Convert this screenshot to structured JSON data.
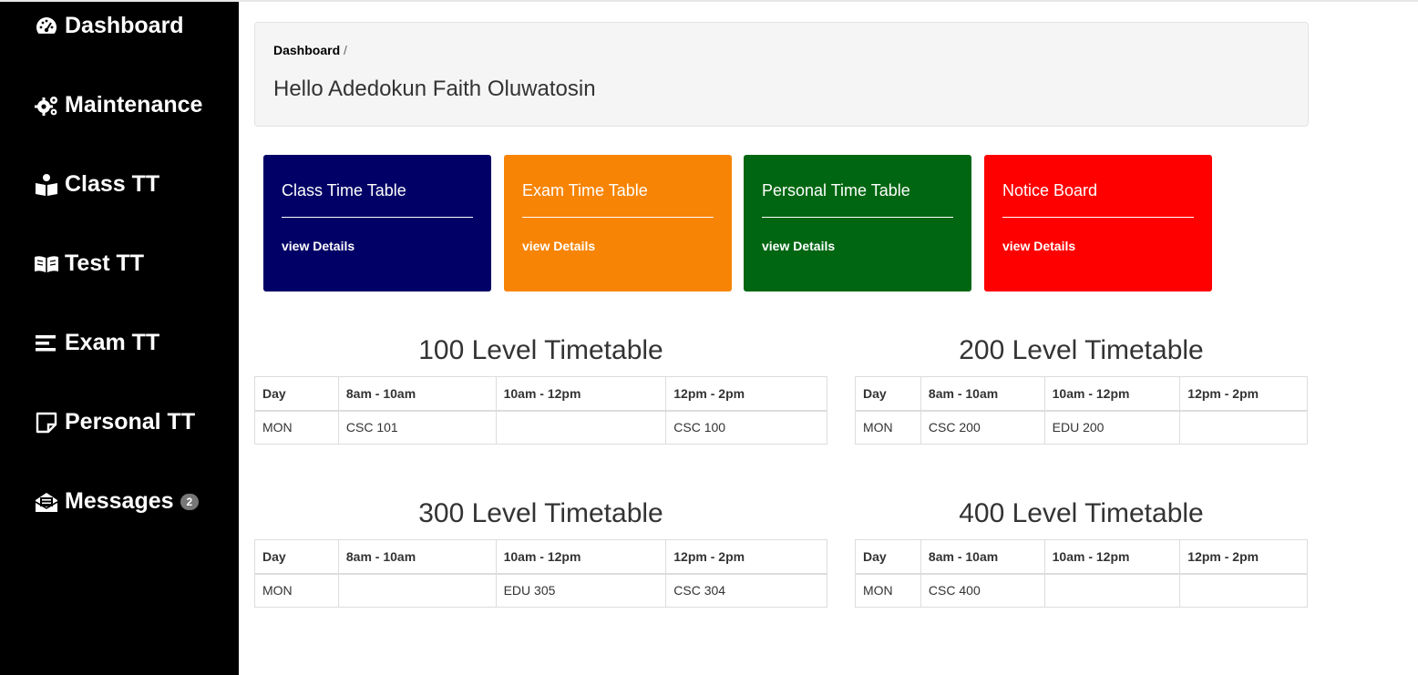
{
  "sidebar": {
    "items": [
      {
        "label": "Dashboard",
        "icon": "dashboard-icon"
      },
      {
        "label": "Maintenance",
        "icon": "gears-icon"
      },
      {
        "label": "Class TT",
        "icon": "reader-icon"
      },
      {
        "label": "Test TT",
        "icon": "open-book-icon"
      },
      {
        "label": "Exam TT",
        "icon": "list-icon"
      },
      {
        "label": "Personal TT",
        "icon": "sticky-note-icon"
      },
      {
        "label": "Messages",
        "icon": "envelope-open-icon",
        "badge": "2"
      }
    ]
  },
  "header": {
    "breadcrumb": "Dashboard",
    "breadcrumb_sep": "/",
    "greeting": "Hello Adedokun Faith Oluwatosin"
  },
  "cards": [
    {
      "title": "Class Time Table",
      "link": "view Details",
      "color": "#000066"
    },
    {
      "title": "Exam Time Table",
      "link": "view Details",
      "color": "#f78404"
    },
    {
      "title": "Personal Time Table",
      "link": "view Details",
      "color": "#006611"
    },
    {
      "title": "Notice Board",
      "link": "view Details",
      "color": "#ff0000"
    }
  ],
  "timetables": [
    {
      "title": "100 Level Timetable",
      "headers": [
        "Day",
        "8am - 10am",
        "10am - 12pm",
        "12pm - 2pm"
      ],
      "row": [
        "MON",
        "CSC 101",
        "",
        "CSC 100"
      ]
    },
    {
      "title": "200 Level Timetable",
      "headers": [
        "Day",
        "8am - 10am",
        "10am - 12pm",
        "12pm - 2pm"
      ],
      "row": [
        "MON",
        "CSC 200",
        "EDU 200",
        ""
      ]
    },
    {
      "title": "300 Level Timetable",
      "headers": [
        "Day",
        "8am - 10am",
        "10am - 12pm",
        "12pm - 2pm"
      ],
      "row": [
        "MON",
        "",
        "EDU 305",
        "CSC 304"
      ]
    },
    {
      "title": "400 Level Timetable",
      "headers": [
        "Day",
        "8am - 10am",
        "10am - 12pm",
        "12pm - 2pm"
      ],
      "row": [
        "MON",
        "CSC 400",
        "",
        ""
      ]
    }
  ]
}
